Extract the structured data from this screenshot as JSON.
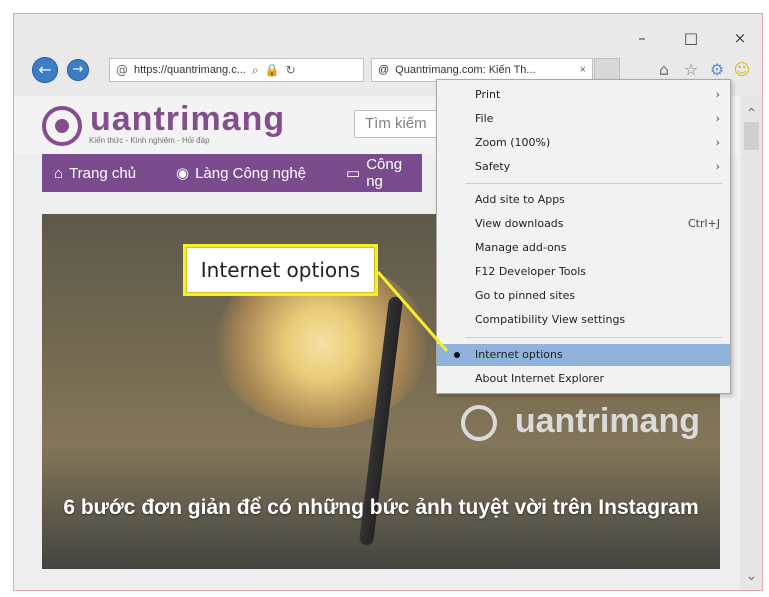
{
  "window": {
    "minimize": "–",
    "maximize": "□",
    "close": "×"
  },
  "toolbar": {
    "address_text": "https://quantrimang.c...",
    "tab_title": "Quantrimang.com: Kiến Th...",
    "tab_close": "×",
    "home_icon": "home-icon",
    "favorites_icon": "star-icon",
    "settings_icon": "gear-icon",
    "smiley_icon": "smiley-icon"
  },
  "site": {
    "logo_text": "uantrimang",
    "logo_sub": "Kiến thức - Kinh nghiệm - Hỏi đáp",
    "search_placeholder": "Tìm kiếm",
    "menu": [
      {
        "label": "Trang chủ"
      },
      {
        "label": "Làng Công nghệ"
      },
      {
        "label": "Công ng"
      }
    ]
  },
  "hero": {
    "logo_text": "uantrimang",
    "title": "6 bước đơn giản để có những bức ảnh tuyệt vời trên Instagram"
  },
  "dropdown": {
    "items": [
      {
        "label": "Print",
        "right": "›"
      },
      {
        "label": "File",
        "right": "›"
      },
      {
        "label": "Zoom (100%)",
        "right": "›"
      },
      {
        "label": "Safety",
        "right": "›"
      },
      {
        "label": "Add site to Apps",
        "right": ""
      },
      {
        "label": "View downloads",
        "right": "Ctrl+J"
      },
      {
        "label": "Manage add-ons",
        "right": ""
      },
      {
        "label": "F12 Developer Tools",
        "right": ""
      },
      {
        "label": "Go to pinned sites",
        "right": ""
      },
      {
        "label": "Compatibility View settings",
        "right": ""
      },
      {
        "label": "Internet options",
        "right": ""
      },
      {
        "label": "About Internet Explorer",
        "right": ""
      }
    ]
  },
  "callout": {
    "text": "Internet options"
  },
  "colors": {
    "accent": "#6f3d85",
    "highlight": "#8fb3da",
    "callout_border": "#f6ee2a"
  }
}
